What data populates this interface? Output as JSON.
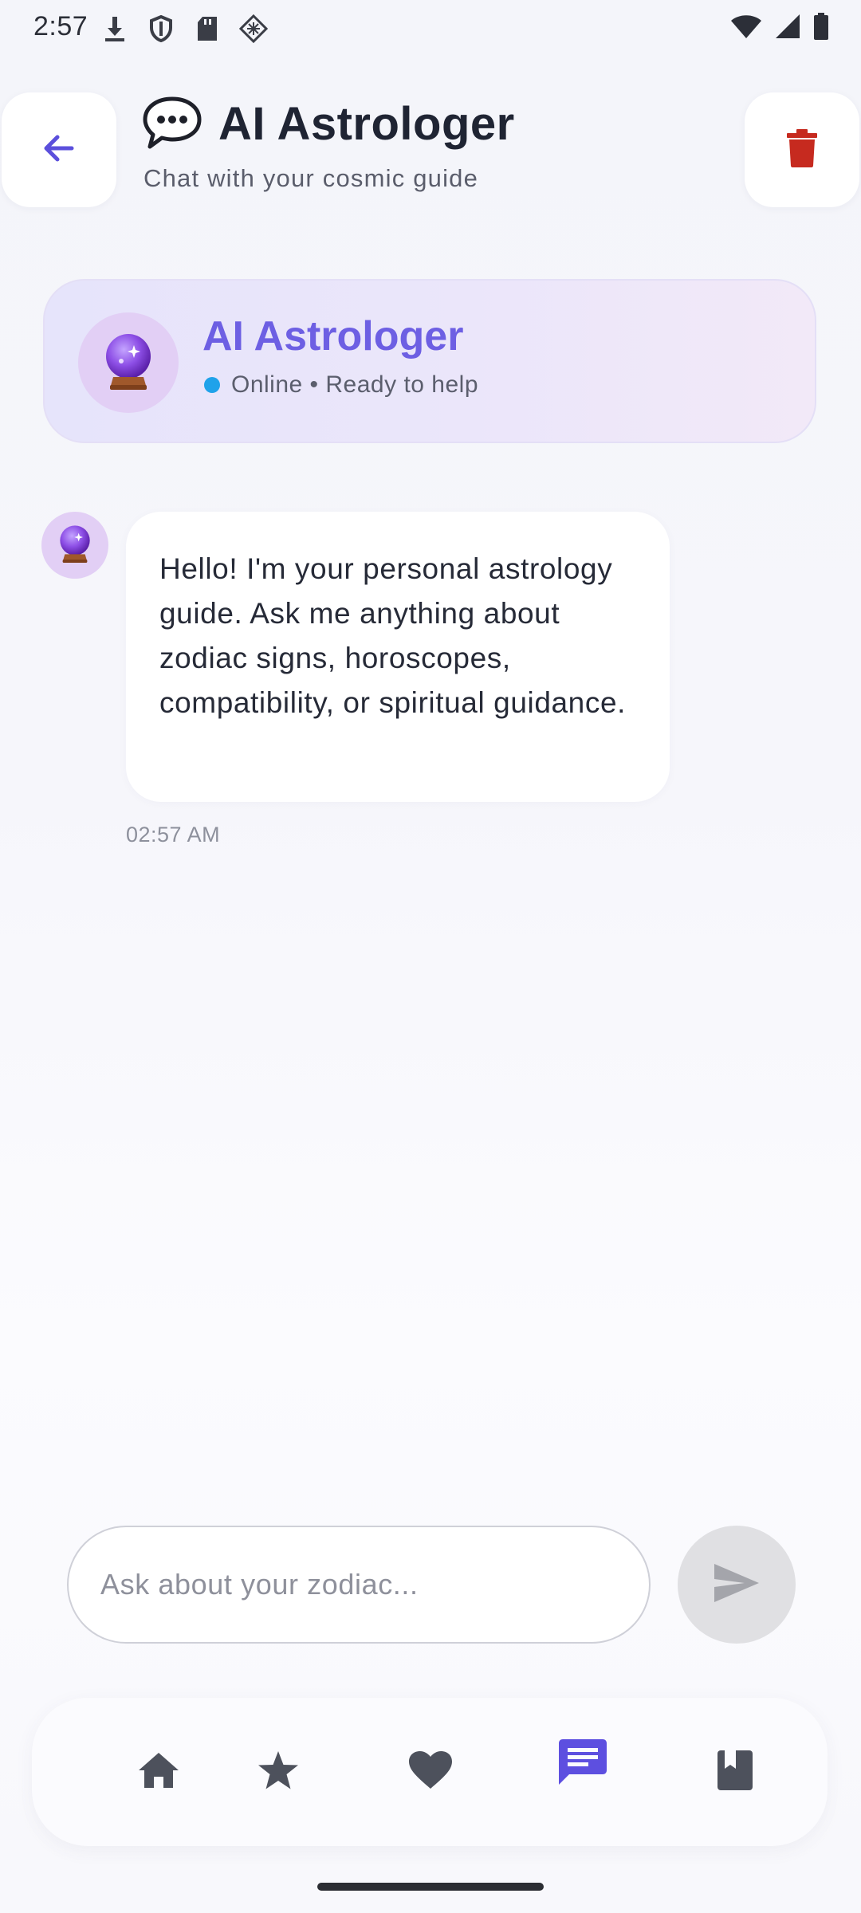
{
  "status_bar": {
    "time": "2:57",
    "icons_left": [
      "download-icon",
      "shield-icon",
      "sd-card-icon",
      "vpn-diamond-icon"
    ],
    "icons_right": [
      "wifi-icon",
      "signal-icon",
      "battery-icon"
    ]
  },
  "header": {
    "title": "AI Astrologer",
    "subtitle": "Chat with your cosmic guide",
    "title_icon": "speech-bubble-icon",
    "back_icon": "arrow-left-icon",
    "delete_icon": "trash-icon"
  },
  "assistant_card": {
    "name": "AI Astrologer",
    "status": "Online • Ready to help",
    "avatar_icon": "crystal-ball-icon"
  },
  "messages": [
    {
      "sender": "assistant",
      "text": "Hello! I'm your personal astrology guide. Ask me anything about zodiac signs, horoscopes, compatibility, or spiritual guidance.",
      "time": "02:57 AM"
    }
  ],
  "input": {
    "placeholder": "Ask about your zodiac...",
    "value": ""
  },
  "bottom_nav": {
    "items": [
      {
        "icon": "home-icon",
        "active": false
      },
      {
        "icon": "star-icon",
        "active": false
      },
      {
        "icon": "heart-icon",
        "active": false
      },
      {
        "icon": "chat-icon",
        "active": true
      },
      {
        "icon": "book-icon",
        "active": false
      }
    ]
  },
  "colors": {
    "accent": "#6d5fe3",
    "nav_active": "#5d4fe0",
    "nav_inactive": "#4d515c",
    "delete": "#c62a1f",
    "online": "#1fa2ea"
  }
}
